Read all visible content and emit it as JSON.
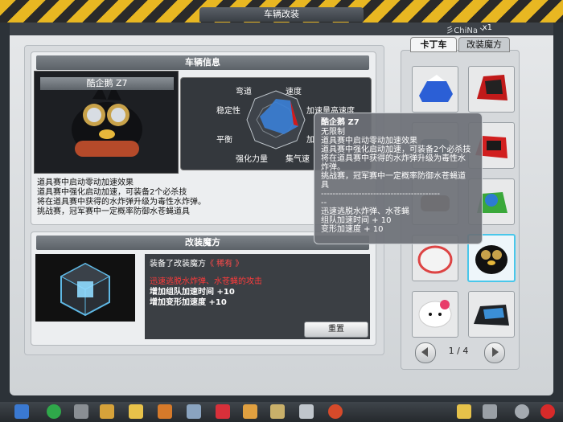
{
  "window": {
    "title": "车辆改装"
  },
  "user": {
    "name": "彡ChiNa丶",
    "close": "x1"
  },
  "info_panel": {
    "title": "车辆信息",
    "car_name": "酷企鹅 Z7",
    "radar_labels": [
      "弯道",
      "速度",
      "稳定性",
      "加速量高速度",
      "平衡",
      "加",
      "强化力量",
      "集气速"
    ],
    "description": [
      "道具赛中启动零动加速效果",
      "道具赛中强化启动加速，可装备2个必杀技",
      "将在道具赛中获得的水炸弹升级为毒性水炸弹。",
      "挑战赛，冠军赛中一定概率防御水苍蝇道具"
    ]
  },
  "magic_panel": {
    "title": "改装魔方",
    "equipped_prefix": "装备了改装魔方",
    "equipped_name": "《 稀有 》",
    "line_red": "迅速逃脱水炸弹、水苍蝇的攻击",
    "line1": "增加组队加速时间 +10",
    "line2": "增加变形加速度 +10",
    "button": "重置"
  },
  "side": {
    "tabs": [
      "卡丁车",
      "改装魔方"
    ],
    "page": "1 / 4",
    "prev_icon": "arrow-left-icon",
    "next_icon": "arrow-right-icon",
    "cars": [
      "blue-white-kart-icon",
      "red-black-kart-icon",
      "kart-3-icon",
      "red-kart-icon",
      "kart-5-icon",
      "green-kart-icon",
      "kart-7-icon",
      "penguin-kart-icon",
      "hello-kitty-kart-icon",
      "black-kart-icon"
    ]
  },
  "tooltip": {
    "title": "酷企鹅 Z7",
    "lines": [
      "无限制",
      "道具赛中启动零动加速效果",
      "道具赛中强化启动加速，可装备2个必杀技",
      "将在道具赛中获得的水炸弹升级为毒性水",
      "炸弹。",
      "挑战赛，冠军赛中一定概率防御水苍蝇道",
      "具",
      "-----------------------------------------",
      "--",
      "迅速逃脱水炸弹、水苍蝇",
      "组队加速时间 + 10",
      "变形加速度 + 10"
    ]
  },
  "taskbar": {
    "icons": [
      "windows-start-icon",
      "back-arrow-icon",
      "cart-icon",
      "trophy-icon",
      "medal-icon",
      "boot-icon",
      "gear-icon",
      "heart-icon",
      "chat-icon",
      "tools-icon",
      "book-icon",
      "world-icon",
      "notes-icon",
      "wrench-icon",
      "search-icon",
      "power-icon"
    ]
  },
  "colors": {
    "accent": "#49c7ea",
    "warning_red": "#ff3b3b",
    "stripe_yellow": "#e8b722"
  }
}
